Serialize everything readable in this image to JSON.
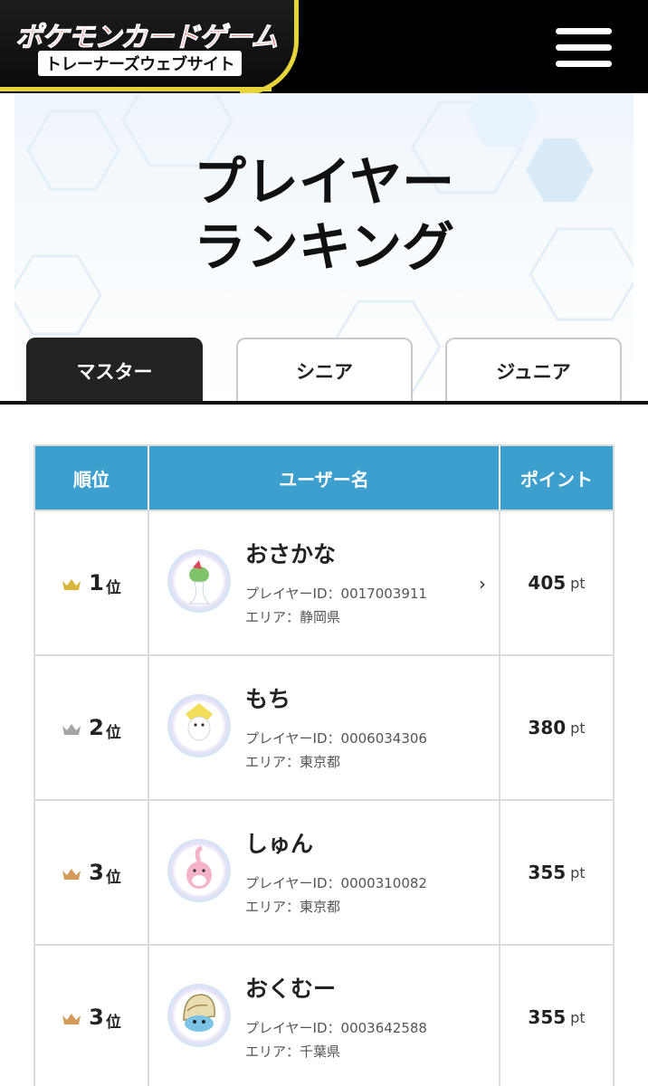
{
  "header": {
    "logo_main": "ポケモンカードゲーム",
    "logo_sub": "トレーナーズウェブサイト",
    "menu_icon": "hamburger-menu-icon"
  },
  "hero": {
    "title_line1": "プレイヤー",
    "title_line2": "ランキング"
  },
  "tabs": [
    {
      "label": "マスター",
      "active": true
    },
    {
      "label": "シニア",
      "active": false
    },
    {
      "label": "ジュニア",
      "active": false
    }
  ],
  "table": {
    "headers": {
      "rank": "順位",
      "username": "ユーザー名",
      "points": "ポイント"
    },
    "rows": [
      {
        "rank": "1",
        "rank_suffix": "位",
        "crown_color": "#d9b53a",
        "name": "おさかな",
        "player_id": "プレイヤーID：0017003911",
        "area": "エリア：静岡県",
        "points": "405",
        "unit": "pt",
        "avatar_icon": "pokemon-avatar-icon",
        "chevron": "›"
      },
      {
        "rank": "2",
        "rank_suffix": "位",
        "crown_color": "#a5a5a5",
        "name": "もち",
        "player_id": "プレイヤーID：0006034306",
        "area": "エリア：東京都",
        "points": "380",
        "unit": "pt",
        "avatar_icon": "pokemon-avatar-icon"
      },
      {
        "rank": "3",
        "rank_suffix": "位",
        "crown_color": "#d39a58",
        "name": "しゅん",
        "player_id": "プレイヤーID：0000310082",
        "area": "エリア：東京都",
        "points": "355",
        "unit": "pt",
        "avatar_icon": "pokemon-avatar-icon"
      },
      {
        "rank": "3",
        "rank_suffix": "位",
        "crown_color": "#d39a58",
        "name": "おくむー",
        "player_id": "プレイヤーID：0003642588",
        "area": "エリア：千葉県",
        "points": "355",
        "unit": "pt",
        "avatar_icon": "pokemon-avatar-icon"
      }
    ]
  },
  "colors": {
    "header_bg": "#000000",
    "logo_gold": "#e7d43a",
    "table_header_bg": "#3d9fce",
    "active_tab_bg": "#222222"
  }
}
